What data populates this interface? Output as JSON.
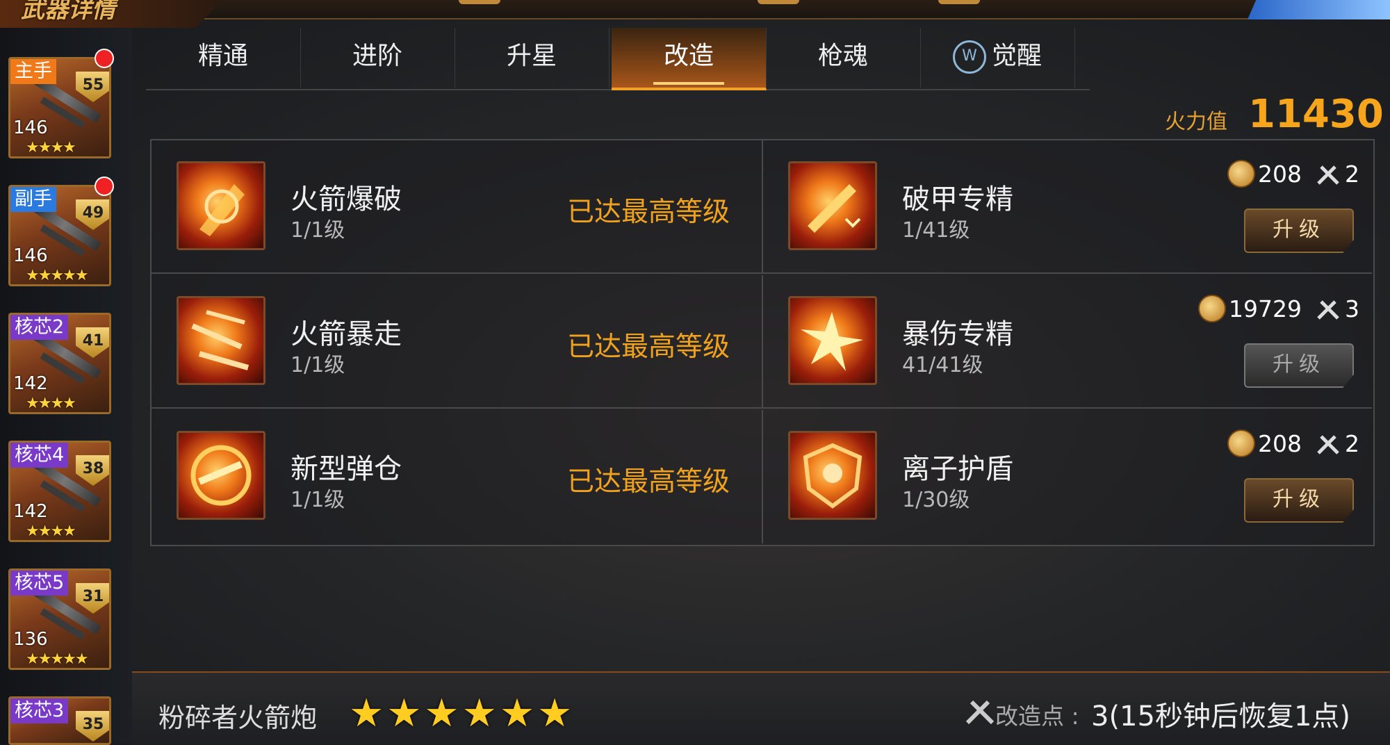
{
  "header": {
    "title": "武器详情"
  },
  "sidebar": {
    "weapons": [
      {
        "slot": "主手",
        "level": "55",
        "power": "146",
        "stars": "★★★★",
        "slot_color": "#f07a1a",
        "alert": true
      },
      {
        "slot": "副手",
        "level": "49",
        "power": "146",
        "stars": "★★★★★",
        "slot_color": "#2a7ae0",
        "alert": true
      },
      {
        "slot": "核芯2",
        "level": "41",
        "power": "142",
        "stars": "★★★★",
        "slot_color": "#7a3ac8",
        "alert": false
      },
      {
        "slot": "核芯4",
        "level": "38",
        "power": "142",
        "stars": "★★★★",
        "slot_color": "#7a3ac8",
        "alert": false
      },
      {
        "slot": "核芯5",
        "level": "31",
        "power": "136",
        "stars": "★★★★★",
        "slot_color": "#7a3ac8",
        "alert": false
      },
      {
        "slot": "核芯3",
        "level": "35",
        "power": "",
        "stars": "",
        "slot_color": "#7a3ac8",
        "alert": false
      }
    ]
  },
  "tabs": [
    {
      "label": "精通"
    },
    {
      "label": "进阶"
    },
    {
      "label": "升星"
    },
    {
      "label": "改造",
      "active": true
    },
    {
      "label": "枪魂"
    },
    {
      "label": "觉醒"
    }
  ],
  "firepower": {
    "label": "火力值",
    "value": "11430"
  },
  "skills": [
    {
      "name": "火箭爆破",
      "level": "1/1级",
      "status": "已达最高等级"
    },
    {
      "name": "破甲专精",
      "level": "1/41级",
      "coins": "208",
      "parts": "2",
      "button": "升级",
      "enabled": true
    },
    {
      "name": "火箭暴走",
      "level": "1/1级",
      "status": "已达最高等级"
    },
    {
      "name": "暴伤专精",
      "level": "41/41级",
      "coins": "19729",
      "parts": "3",
      "button": "升级",
      "enabled": false
    },
    {
      "name": "新型弹仓",
      "level": "1/1级",
      "status": "已达最高等级"
    },
    {
      "name": "离子护盾",
      "level": "1/30级",
      "coins": "208",
      "parts": "2",
      "button": "升级",
      "enabled": true
    }
  ],
  "footer": {
    "weapon_name": "粉碎者火箭炮",
    "stars": "★★★★★★",
    "mod_label": "改造点 :",
    "mod_value": "3(15秒钟后恢复1点)"
  },
  "colors": {
    "accent": "#f7a51c",
    "maxed": "#f0a21e"
  }
}
